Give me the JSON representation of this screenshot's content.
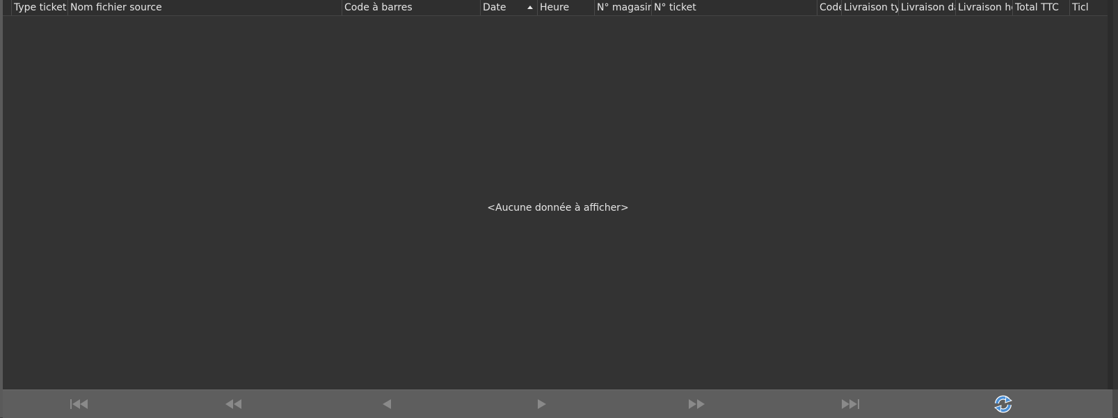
{
  "grid": {
    "columns": [
      {
        "label": "Type ticket"
      },
      {
        "label": "Nom fichier source"
      },
      {
        "label": "Code à barres"
      },
      {
        "label": "Date"
      },
      {
        "label": "Heure"
      },
      {
        "label": "N° magasin"
      },
      {
        "label": "N° ticket"
      },
      {
        "label": "Code"
      },
      {
        "label": "Livraison typ"
      },
      {
        "label": "Livraison da"
      },
      {
        "label": "Livraison he"
      },
      {
        "label": "Total TTC"
      },
      {
        "label": "Ticl"
      }
    ],
    "sorted_column": "Date",
    "empty_message": "<Aucune donnée à afficher>"
  },
  "navigator": {
    "buttons": [
      {
        "icon": "first-page-icon"
      },
      {
        "icon": "previous-page-icon"
      },
      {
        "icon": "previous-record-icon"
      },
      {
        "icon": "next-record-icon"
      },
      {
        "icon": "next-page-icon"
      },
      {
        "icon": "last-page-icon"
      },
      {
        "icon": "refresh-icon"
      }
    ]
  },
  "colors": {
    "background": "#333333",
    "header_text": "#e6e6e6",
    "navbar": "#5e5e5e",
    "nav_icon": "#8a8a8a",
    "refresh_accent": "#4a8fd6"
  }
}
